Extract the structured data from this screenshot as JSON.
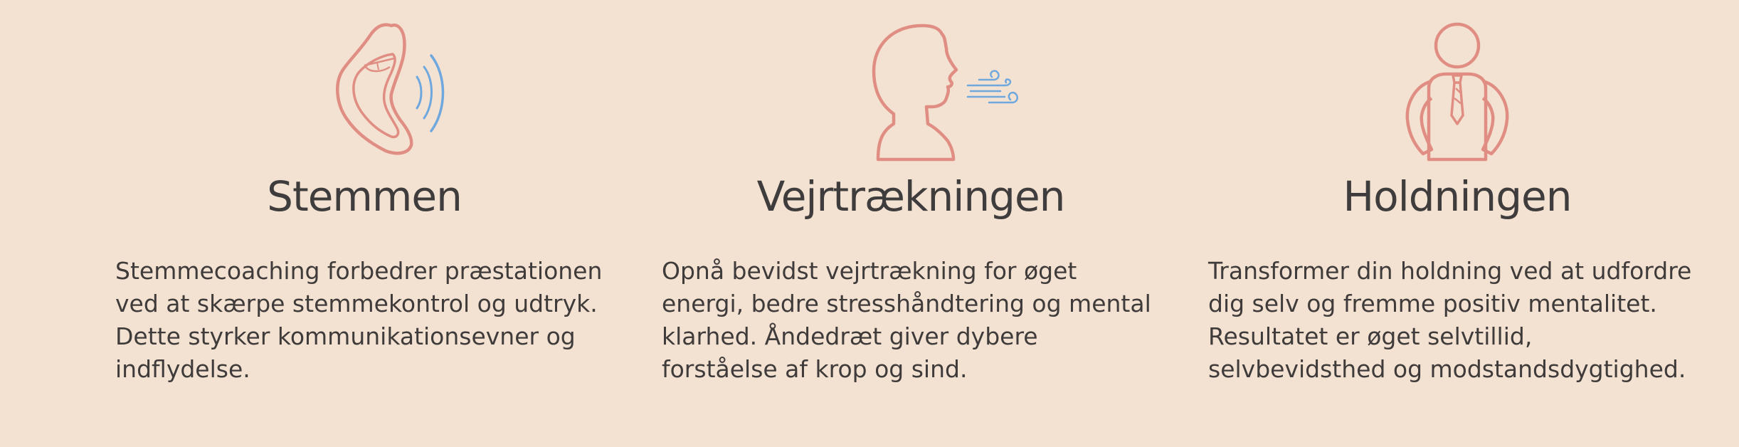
{
  "colors": {
    "background": "#f3e2d1",
    "icon_stroke": "#e08e83",
    "icon_accent": "#6fa8de",
    "text": "#3e3c3c"
  },
  "features": [
    {
      "icon": "mouth-sound-icon",
      "title": "Stemmen",
      "description": "Stemmecoaching forbedrer præstationen ved at skærpe stemmekontrol og udtryk. Dette styrker kommunikationsevner og indflydelse."
    },
    {
      "icon": "head-breathing-icon",
      "title": "Vejrtrækningen",
      "description": "Opnå bevidst vejrtrækning for øget energi, bedre stresshåndtering og mental klarhed. Åndedræt giver dybere forståelse af krop og sind."
    },
    {
      "icon": "person-posture-icon",
      "title": "Holdningen",
      "description": "Transformer din holdning ved at udfordre dig selv og fremme positiv mentalitet. Resultatet er øget selvtillid, selvbevidsthed og modstandsdygtighed."
    }
  ]
}
